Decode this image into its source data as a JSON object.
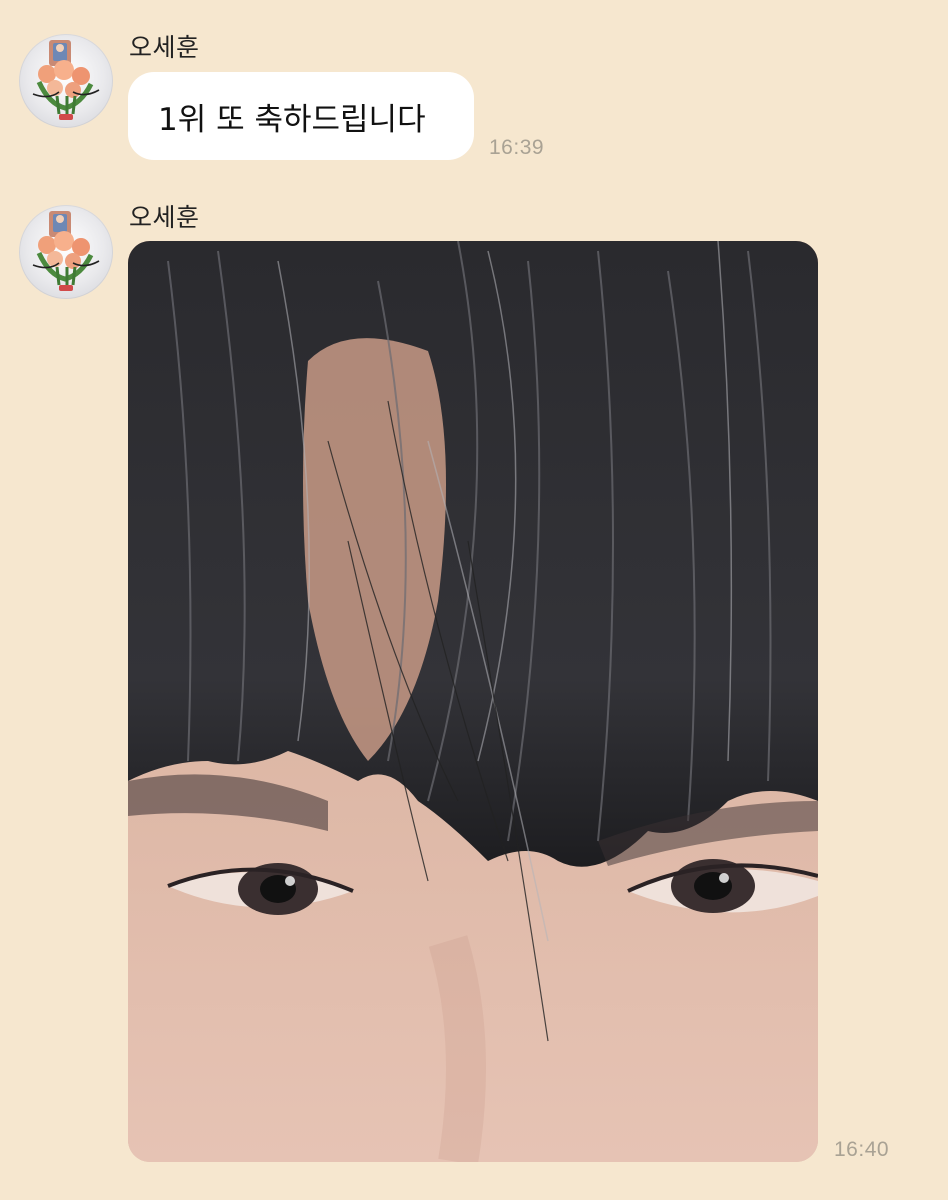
{
  "chat": {
    "messages": [
      {
        "sender": "오세훈",
        "type": "text",
        "text": "1위 또 축하드립니다",
        "time": "16:39"
      },
      {
        "sender": "오세훈",
        "type": "image",
        "image_alt": "close-up selfie of forehead with dark hair bangs and eyes",
        "time": "16:40"
      }
    ]
  },
  "colors": {
    "background": "#f6e7cf",
    "bubble": "#ffffff",
    "timestamp": "#a9a294"
  }
}
